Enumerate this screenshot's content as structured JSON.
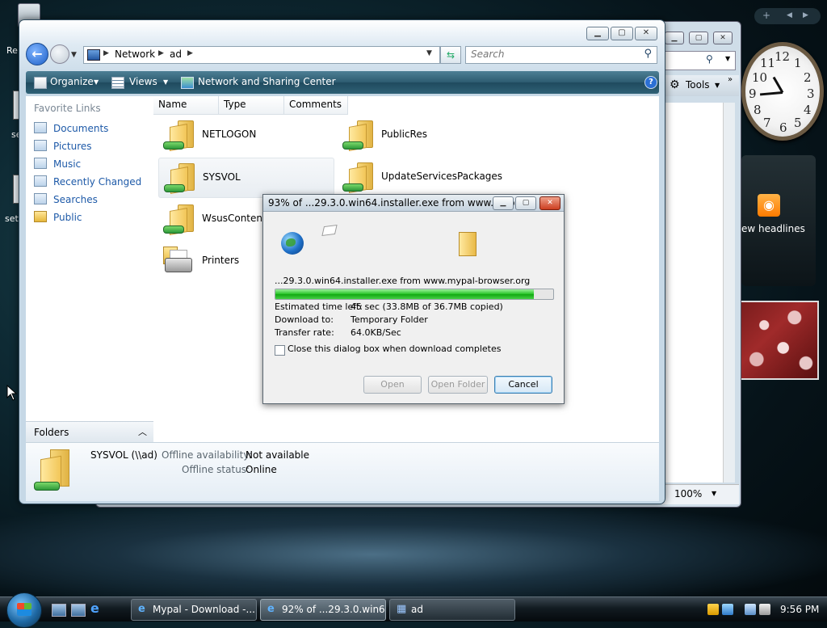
{
  "desktop": {
    "recycle_label": "Re",
    "left_labels": [
      "se",
      "set"
    ]
  },
  "gadgets": {
    "feed_text": "ew headlines",
    "clock": {
      "numbers": [
        "12",
        "1",
        "2",
        "3",
        "4",
        "5",
        "6",
        "7",
        "8",
        "9",
        "10",
        "11"
      ]
    }
  },
  "bg_window": {
    "tools_label": "Tools",
    "zoom": "100%"
  },
  "explorer": {
    "address": {
      "crumbs": [
        "Network",
        "ad"
      ]
    },
    "search_placeholder": "Search",
    "commands": {
      "organize": "Organize",
      "views": "Views",
      "network_center": "Network and Sharing Center"
    },
    "nav": {
      "title": "Favorite Links",
      "links": [
        "Documents",
        "Pictures",
        "Music",
        "Recently Changed",
        "Searches",
        "Public"
      ],
      "folders_label": "Folders"
    },
    "columns": [
      "Name",
      "Type",
      "Comments"
    ],
    "items": [
      "NETLOGON",
      "PublicRes",
      "SYSVOL",
      "UpdateServicesPackages",
      "WsusContent",
      "Printers"
    ],
    "details": {
      "name": "SYSVOL (\\\\ad)",
      "offline_availability_label": "Offline availability:",
      "offline_availability_value": "Not available",
      "offline_status_label": "Offline status:",
      "offline_status_value": "Online"
    }
  },
  "download": {
    "title": "93% of ...29.3.0.win64.installer.exe from www.myp...",
    "file": "...29.3.0.win64.installer.exe from www.mypal-browser.org",
    "progress": 0.93,
    "time_left_label": "Estimated time left:",
    "time_left_value": "45 sec (33.8MB of 36.7MB copied)",
    "download_to_label": "Download to:",
    "download_to_value": "Temporary Folder",
    "rate_label": "Transfer rate:",
    "rate_value": "64.0KB/Sec",
    "close_when_done_label": "Close this dialog box when download completes",
    "close_when_done_checked": false,
    "buttons": {
      "open": "Open",
      "open_folder": "Open Folder",
      "cancel": "Cancel"
    }
  },
  "taskbar": {
    "tasks": [
      "Mypal - Download -...",
      "92% of ...29.3.0.win6...",
      "ad"
    ],
    "clock": "9:56 PM"
  }
}
